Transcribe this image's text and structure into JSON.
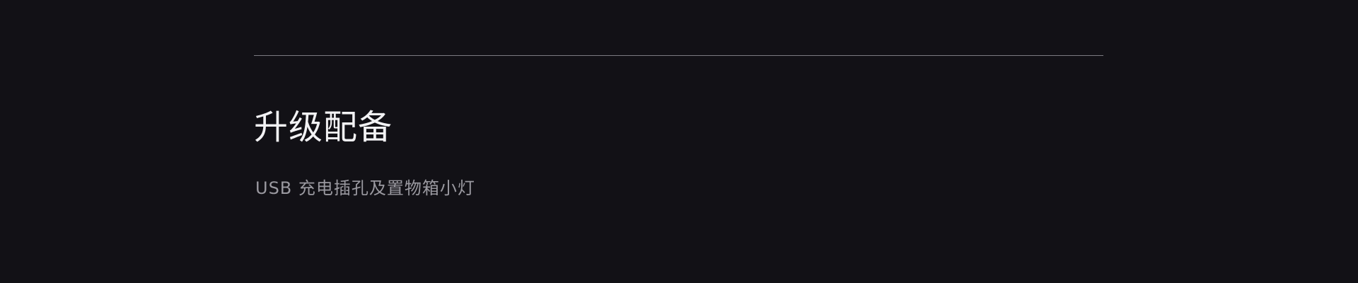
{
  "section": {
    "title": "升级配备",
    "description": "USB 充电插孔及置物箱小灯"
  },
  "colors": {
    "background": "#121116",
    "divider": "#7b7a80",
    "title": "#f2f2f4",
    "description": "#9a99a0"
  }
}
